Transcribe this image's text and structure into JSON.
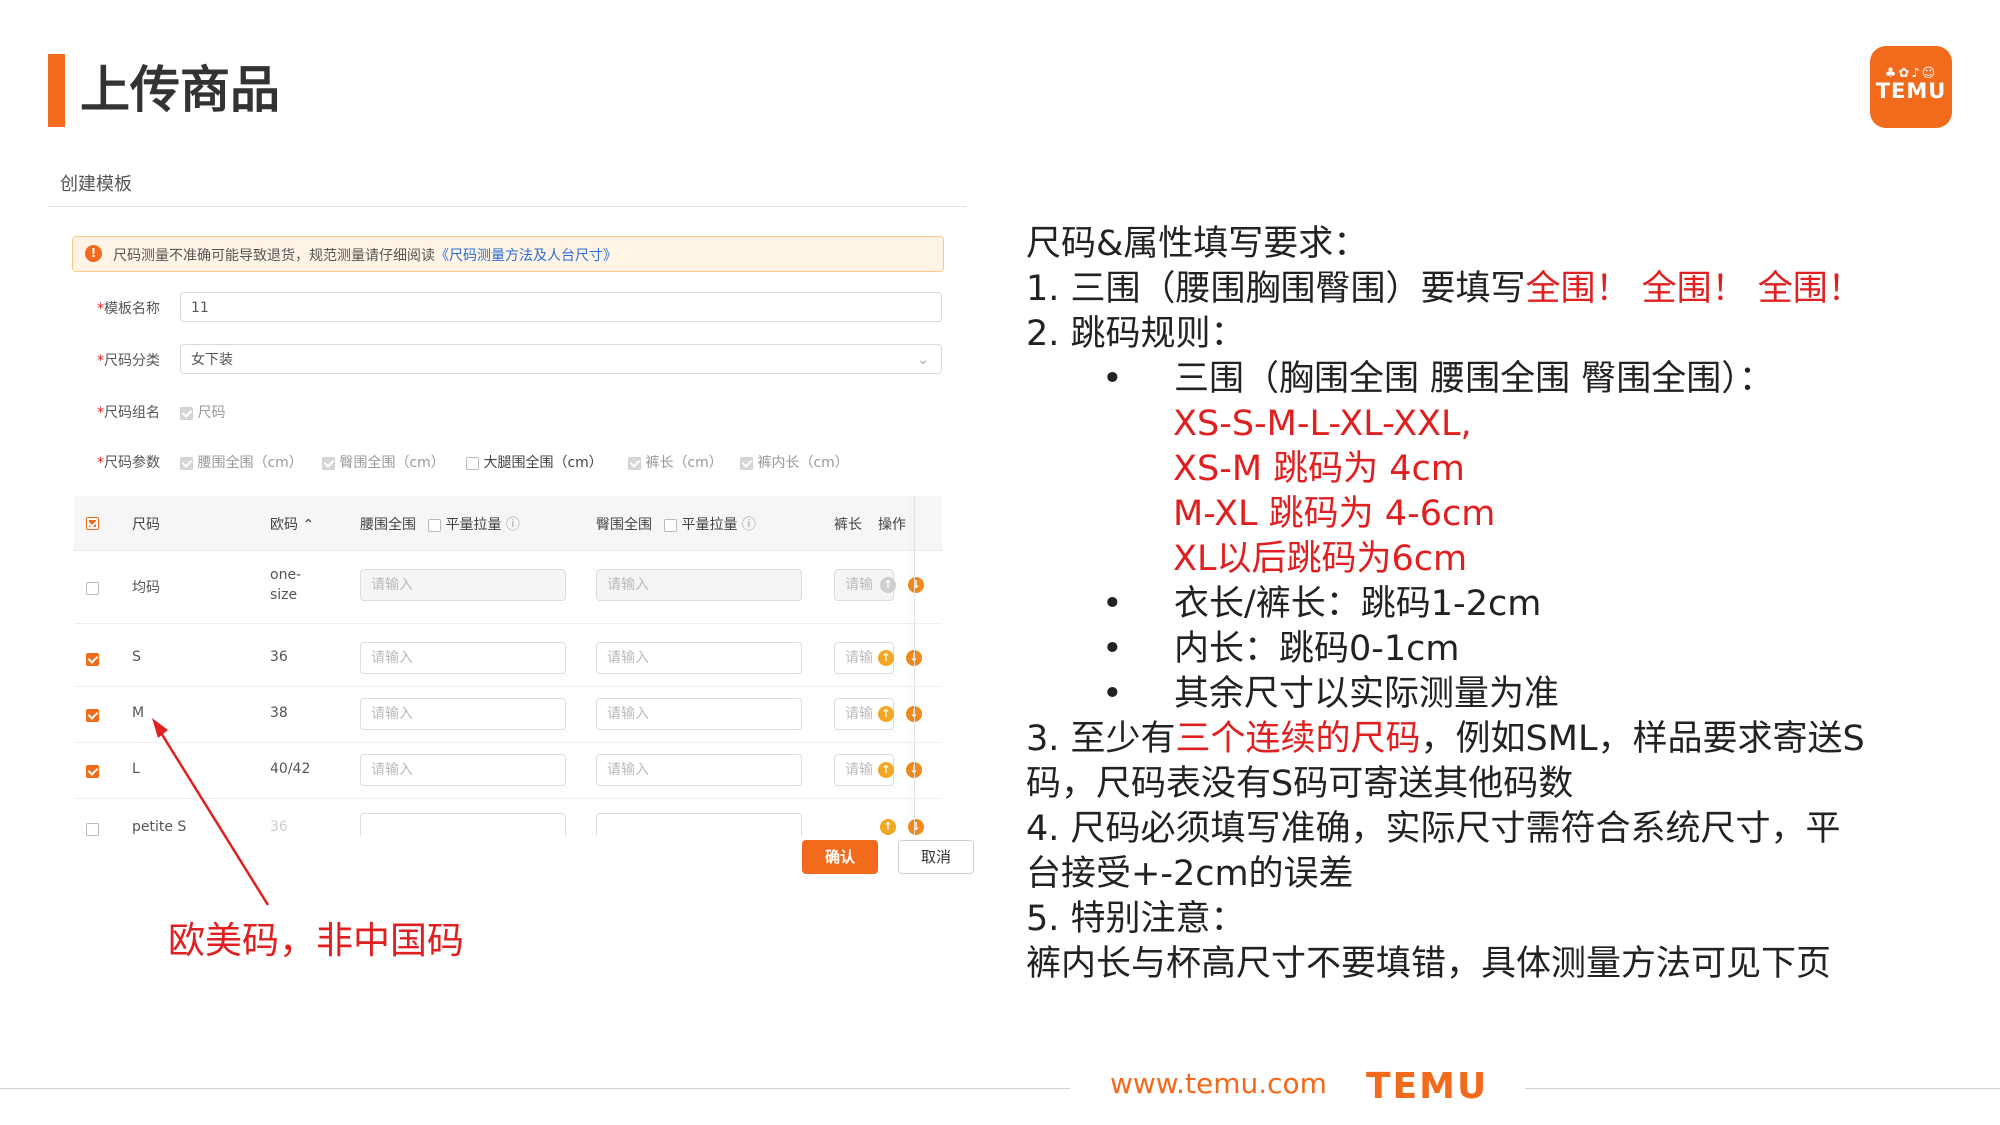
{
  "header": {
    "title": "上传商品"
  },
  "logo": {
    "glyphs": "♣✿♪☺",
    "word": "TEMU"
  },
  "panel": {
    "title": "创建模板",
    "notice": {
      "text": "尺码测量不准确可能导致退货，规范测量请仔细阅读",
      "link": "《尺码测量方法及人台尺寸》"
    },
    "fields": {
      "template_name": {
        "label": "模板名称",
        "value": "11"
      },
      "size_category": {
        "label": "尺码分类",
        "value": "女下装"
      },
      "size_group": {
        "label": "尺码组名",
        "option": "尺码"
      },
      "size_params": {
        "label": "尺码参数",
        "options": [
          "腰围全围（cm）",
          "臀围全围（cm）",
          "大腿围全围（cm）",
          "裤长（cm）",
          "裤内长（cm）"
        ]
      }
    },
    "table": {
      "headers": {
        "size": "尺码",
        "eu": "欧码",
        "waist": "腰围全围",
        "flat1": "平量拉量",
        "hip": "臀围全围",
        "flat2": "平量拉量",
        "length": "裤长",
        "ops": "操作"
      },
      "placeholder": "请输入",
      "rows": [
        {
          "size": "均码",
          "eu": "one-size",
          "checked": false
        },
        {
          "size": "S",
          "eu": "36",
          "checked": true
        },
        {
          "size": "M",
          "eu": "38",
          "checked": true
        },
        {
          "size": "L",
          "eu": "40/42",
          "checked": true
        },
        {
          "size": "petite S",
          "eu": "36",
          "checked": false
        }
      ],
      "partial_placeholder": "请输"
    },
    "buttons": {
      "confirm": "确认",
      "cancel": "取消"
    }
  },
  "annotation": "欧美码，非中国码",
  "rules": {
    "heading": "尺码&属性填写要求：",
    "item1_prefix": "1.   三围（腰围胸围臀围）要填写",
    "item1_red": "全围！ 全围！ 全围！",
    "item2": "2.   跳码规则：",
    "sub1": "三围（胸围全围 腰围全围 臀围全围）：",
    "sub1_red": [
      "XS-S-M-L-XL-XXL,",
      "XS-M 跳码为 4cm",
      "M-XL 跳码为 4-6cm",
      "XL以后跳码为6cm"
    ],
    "sub2": "衣长/裤长：跳码1-2cm",
    "sub3": "内长：跳码0-1cm",
    "sub4": "其余尺寸以实际测量为准",
    "item3_prefix": "3. 至少有",
    "item3_red": "三个连续的尺码",
    "item3_suffix": "，例如SML，样品要求寄送S",
    "item3_line2": "码，尺码表没有S码可寄送其他码数",
    "item4_line1": "4. 尺码必须填写准确，实际尺寸需符合系统尺寸，平",
    "item4_line2": "台接受+-2cm的误差",
    "item5": "5. 特别注意：",
    "item5_line2": "裤内长与杯高尺寸不要填错，具体测量方法可见下页"
  },
  "footer": {
    "url": "www.temu.com",
    "brand": "TEMU"
  },
  "colors": {
    "accent": "#f26a1b",
    "red": "#e02020",
    "link": "#2a6ed6"
  }
}
